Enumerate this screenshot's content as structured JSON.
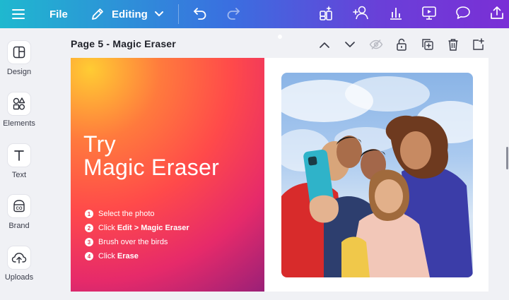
{
  "topbar": {
    "file_label": "File",
    "editing_label": "Editing",
    "icons": [
      "menu-icon",
      "pencil-icon",
      "chevron-down-icon",
      "undo-icon",
      "redo-icon",
      "magic-apps-icon",
      "share-people-icon",
      "insights-icon",
      "present-icon",
      "comment-icon",
      "export-icon"
    ]
  },
  "sidebar": {
    "items": [
      {
        "label": "Design"
      },
      {
        "label": "Elements"
      },
      {
        "label": "Text"
      },
      {
        "label": "Brand"
      },
      {
        "label": "Uploads"
      }
    ]
  },
  "page": {
    "title": "Page 5 - Magic Eraser"
  },
  "slide": {
    "title_line1": "Try",
    "title_line2": "Magic Eraser",
    "steps": [
      {
        "num": "1",
        "pre": "Select the photo",
        "bold": "",
        "post": ""
      },
      {
        "num": "2",
        "pre": "Click ",
        "bold": "Edit > Magic Eraser",
        "post": ""
      },
      {
        "num": "3",
        "pre": "Brush over the birds",
        "bold": "",
        "post": ""
      },
      {
        "num": "4",
        "pre": "Click ",
        "bold": "Erase",
        "post": ""
      }
    ]
  },
  "colors": {
    "topbar_start": "#1fb8cf",
    "topbar_end": "#7a2fd6",
    "accent_orange": "#ff7a3d",
    "accent_pink": "#e62a6a"
  }
}
